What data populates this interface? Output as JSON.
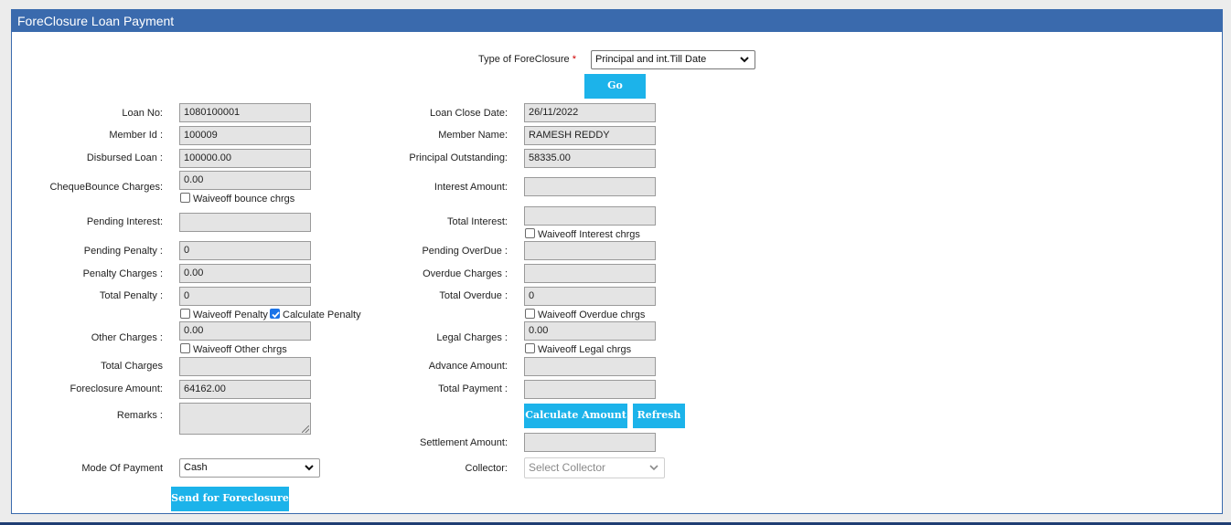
{
  "panel": {
    "title": "ForeClosure Loan Payment"
  },
  "foreclosure_type": {
    "label": "Type of ForeClosure",
    "required_mark": "*",
    "selected": "Principal and int.Till Date"
  },
  "buttons": {
    "go": "Go",
    "calculate": "Calculate Amount",
    "refresh": "Refresh",
    "send": "Send for Foreclosure"
  },
  "left": {
    "loan_no": {
      "label": "Loan No:",
      "value": "1080100001"
    },
    "member_id": {
      "label": "Member Id :",
      "value": "100009"
    },
    "disbursed_loan": {
      "label": "Disbursed Loan :",
      "value": "100000.00"
    },
    "cheque_bounce": {
      "label": "ChequeBounce Charges:",
      "value": "0.00"
    },
    "pending_interest": {
      "label": "Pending Interest:",
      "value": ""
    },
    "pending_penalty": {
      "label": "Pending Penalty :",
      "value": "0"
    },
    "penalty_charges": {
      "label": "Penalty Charges :",
      "value": "0.00"
    },
    "total_penalty": {
      "label": "Total Penalty :",
      "value": "0"
    },
    "other_charges": {
      "label": "Other Charges :",
      "value": "0.00"
    },
    "total_charges": {
      "label": "Total Charges",
      "value": ""
    },
    "foreclosure_amount": {
      "label": "Foreclosure Amount:",
      "value": "64162.00"
    },
    "remarks": {
      "label": "Remarks :",
      "value": ""
    },
    "mode_of_payment": {
      "label": "Mode Of Payment",
      "selected": "Cash"
    }
  },
  "right": {
    "loan_close_date": {
      "label": "Loan Close Date:",
      "value": "26/11/2022"
    },
    "member_name": {
      "label": "Member Name:",
      "value": "RAMESH REDDY"
    },
    "principal_outstanding": {
      "label": "Principal Outstanding:",
      "value": "58335.00"
    },
    "interest_amount": {
      "label": "Interest Amount:",
      "value": ""
    },
    "total_interest": {
      "label": "Total Interest:",
      "value": ""
    },
    "pending_overdue": {
      "label": "Pending OverDue :",
      "value": ""
    },
    "overdue_charges": {
      "label": "Overdue Charges :",
      "value": ""
    },
    "total_overdue": {
      "label": "Total Overdue :",
      "value": "0"
    },
    "legal_charges": {
      "label": "Legal Charges :",
      "value": "0.00"
    },
    "advance_amount": {
      "label": "Advance Amount:",
      "value": ""
    },
    "total_payment": {
      "label": "Total Payment :",
      "value": ""
    },
    "settlement_amount": {
      "label": "Settlement Amount:",
      "value": ""
    },
    "collector": {
      "label": "Collector:",
      "placeholder": "Select Collector"
    }
  },
  "checkboxes": {
    "waive_bounce": {
      "label": "Waiveoff bounce chrgs",
      "checked": false
    },
    "waive_interest": {
      "label": "Waiveoff Interest chrgs",
      "checked": false
    },
    "waive_penalty": {
      "label": "Waiveoff Penalty",
      "checked": false
    },
    "calculate_penalty": {
      "label": "Calculate Penalty",
      "checked": true
    },
    "waive_overdue": {
      "label": "Waiveoff Overdue chrgs",
      "checked": false
    },
    "waive_other": {
      "label": "Waiveoff Other chrgs",
      "checked": false
    },
    "waive_legal": {
      "label": "Waiveoff Legal chrgs",
      "checked": false
    }
  },
  "colors": {
    "header": "#3a6aad",
    "button": "#1cb3ea",
    "field_bg": "#e4e4e4",
    "checkbox_checked": "#1a73e8"
  }
}
